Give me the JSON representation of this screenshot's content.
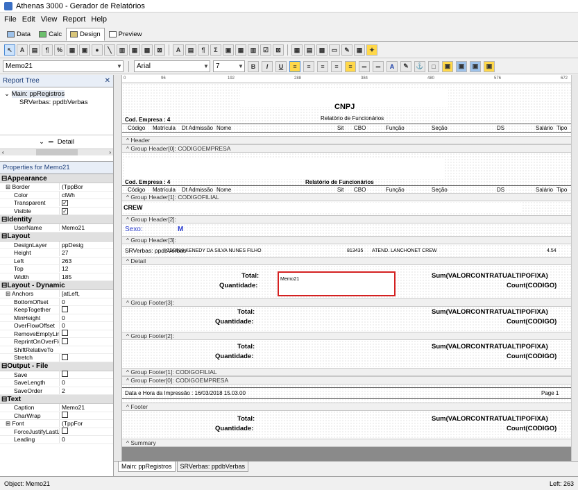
{
  "window": {
    "title": "Athenas 3000 - Gerador de Relatórios"
  },
  "menu": [
    "File",
    "Edit",
    "View",
    "Report",
    "Help"
  ],
  "tabs": [
    {
      "label": "Data",
      "active": false
    },
    {
      "label": "Calc",
      "active": false
    },
    {
      "label": "Design",
      "active": true
    },
    {
      "label": "Preview",
      "active": false
    }
  ],
  "toolbar2": {
    "component": "Memo21",
    "font": "Arial",
    "size": "7"
  },
  "report_tree": {
    "title": "Report Tree",
    "main": "Main: ppRegistros",
    "child": "SRVerbas: ppdbVerbas",
    "band": "Detail"
  },
  "properties": {
    "title": "Properties for Memo21",
    "groups": [
      {
        "name": "Appearance",
        "rows": [
          {
            "k": "Border",
            "v": "(TppBor",
            "expand": true
          },
          {
            "k": "Color",
            "v": "clWh"
          },
          {
            "k": "Transparent",
            "v": "✓",
            "check": true
          },
          {
            "k": "Visible",
            "v": "✓",
            "check": true
          }
        ]
      },
      {
        "name": "Identity",
        "rows": [
          {
            "k": "UserName",
            "v": "Memo21"
          }
        ]
      },
      {
        "name": "Layout",
        "rows": [
          {
            "k": "DesignLayer",
            "v": "ppDesig"
          },
          {
            "k": "Height",
            "v": "27"
          },
          {
            "k": "Left",
            "v": "263"
          },
          {
            "k": "Top",
            "v": "12"
          },
          {
            "k": "Width",
            "v": "185"
          }
        ]
      },
      {
        "name": "Layout - Dynamic",
        "rows": [
          {
            "k": "Anchors",
            "v": "[atLeft,",
            "expand": true
          },
          {
            "k": "BottomOffset",
            "v": "0"
          },
          {
            "k": "KeepTogether",
            "v": "",
            "check": true
          },
          {
            "k": "MinHeight",
            "v": "0"
          },
          {
            "k": "OverFlowOffset",
            "v": "0"
          },
          {
            "k": "RemoveEmptyLine",
            "v": "",
            "check": true
          },
          {
            "k": "ReprintOnOverFlo",
            "v": "",
            "check": true
          },
          {
            "k": "ShiftRelativeTo",
            "v": ""
          },
          {
            "k": "Stretch",
            "v": "",
            "check": true
          }
        ]
      },
      {
        "name": "Output - File",
        "rows": [
          {
            "k": "Save",
            "v": "",
            "check": true
          },
          {
            "k": "SaveLength",
            "v": "0"
          },
          {
            "k": "SaveOrder",
            "v": "2"
          }
        ]
      },
      {
        "name": "Text",
        "rows": [
          {
            "k": "Caption",
            "v": "Memo21"
          },
          {
            "k": "CharWrap",
            "v": "",
            "check": true
          },
          {
            "k": "Font",
            "v": "(TppFor",
            "expand": true
          },
          {
            "k": "ForceJustifyLastLi",
            "v": "",
            "check": true
          },
          {
            "k": "Leading",
            "v": "0"
          }
        ]
      }
    ]
  },
  "ruler": [
    "0",
    "96",
    "192",
    "288",
    "384",
    "480",
    "576",
    "672"
  ],
  "report": {
    "cnpj": "CNPJ",
    "relatorio": "Relatório de Funcionários",
    "cod_empresa": "Cod. Empresa : 4",
    "cols": [
      "Código",
      "Matrícula",
      "Dt Admissão",
      "Nome",
      "Sit",
      "CBO",
      "Função",
      "Seção",
      "DS",
      "Salário",
      "Tipo"
    ],
    "bands": {
      "header": "Header",
      "gh0": "Group Header[0]: CODIGOEMPRESA",
      "gh1": "Group Header[1]: CODIGOFILIAL",
      "gh2": "Group Header[2]:",
      "gh3": "Group Header[3]:",
      "detail": "Detail",
      "gf3": "Group Footer[3]:",
      "gf2": "Group Footer[2]:",
      "gf1": "Group Footer[1]: CODIGOFILIAL",
      "gf0": "Group Footer[0]: CODIGOEMPRESA",
      "footer": "Footer",
      "summary": "Summary"
    },
    "crew": "CREW",
    "sexo": "Sexo:",
    "sexo_val": "M",
    "gh3_row": "SRVerbas: ppdbVerbas",
    "gh3_row2": "01/2018   KENEDY DA SILVA NUNES FILHO",
    "gh3_row3": "813435",
    "gh3_row4": "ATEND. LANCHONET CREW",
    "gh3_row5": "4.54",
    "total": "Total:",
    "quantidade": "Quantidade:",
    "sum": "Sum(VALORCONTRATUALTIPOFIXA)",
    "count": "Count(CODIGO)",
    "memo": "Memo21",
    "footer_date": "Data e Hora da Impressão : 16/03/2018 15.03.00",
    "footer_page": "Page 1"
  },
  "bottom_tabs": [
    "Main: ppRegistros",
    "SRVerbas: ppdbVerbas"
  ],
  "status": {
    "object": "Object: Memo21",
    "left": "Left: 263"
  }
}
